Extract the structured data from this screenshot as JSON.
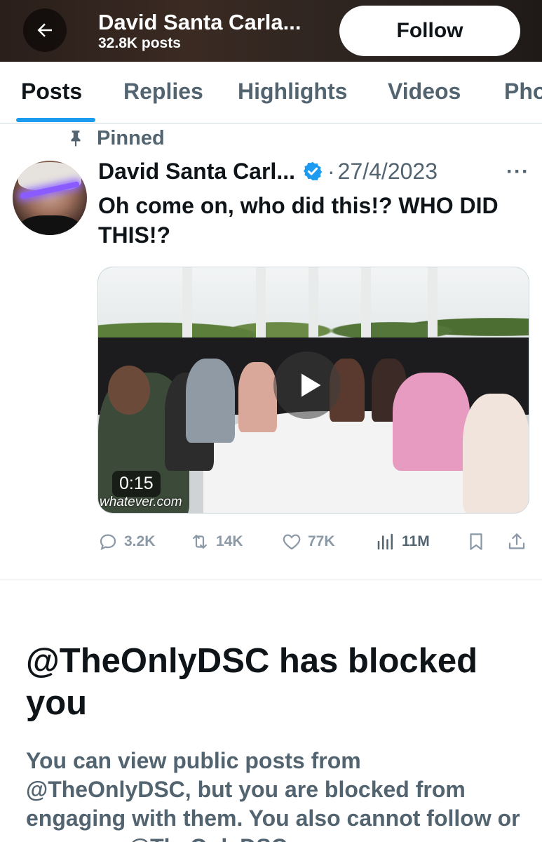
{
  "header": {
    "name": "David Santa Carla...",
    "post_count": "32.8K posts",
    "follow_label": "Follow",
    "back_icon": "arrow-left-icon"
  },
  "tabs": [
    {
      "label": "Posts",
      "active": true
    },
    {
      "label": "Replies",
      "active": false
    },
    {
      "label": "Highlights",
      "active": false
    },
    {
      "label": "Videos",
      "active": false
    },
    {
      "label": "Pho",
      "active": false
    }
  ],
  "post": {
    "pinned_label": "Pinned",
    "author_name": "David Santa Carl...",
    "verified": true,
    "separator": "·",
    "date": "27/4/2023",
    "more_label": "···",
    "text": "Oh come on, who did this!? WHO DID THIS!?",
    "media": {
      "type": "video",
      "duration": "0:15",
      "watermark": "whatever.com"
    },
    "stats": {
      "replies": "3.2K",
      "reposts": "14K",
      "likes": "77K",
      "views": "11M"
    }
  },
  "blocked": {
    "title": "@TheOnlyDSC has blocked you",
    "body": "You can view public posts from @TheOnlyDSC, but you are blocked from engaging with them. You also cannot follow or message @TheOnlyDSC."
  },
  "colors": {
    "accent": "#1d9bf0",
    "text_primary": "#0f1419",
    "text_secondary": "#536471",
    "verified_badge": "#1d9bf0"
  }
}
